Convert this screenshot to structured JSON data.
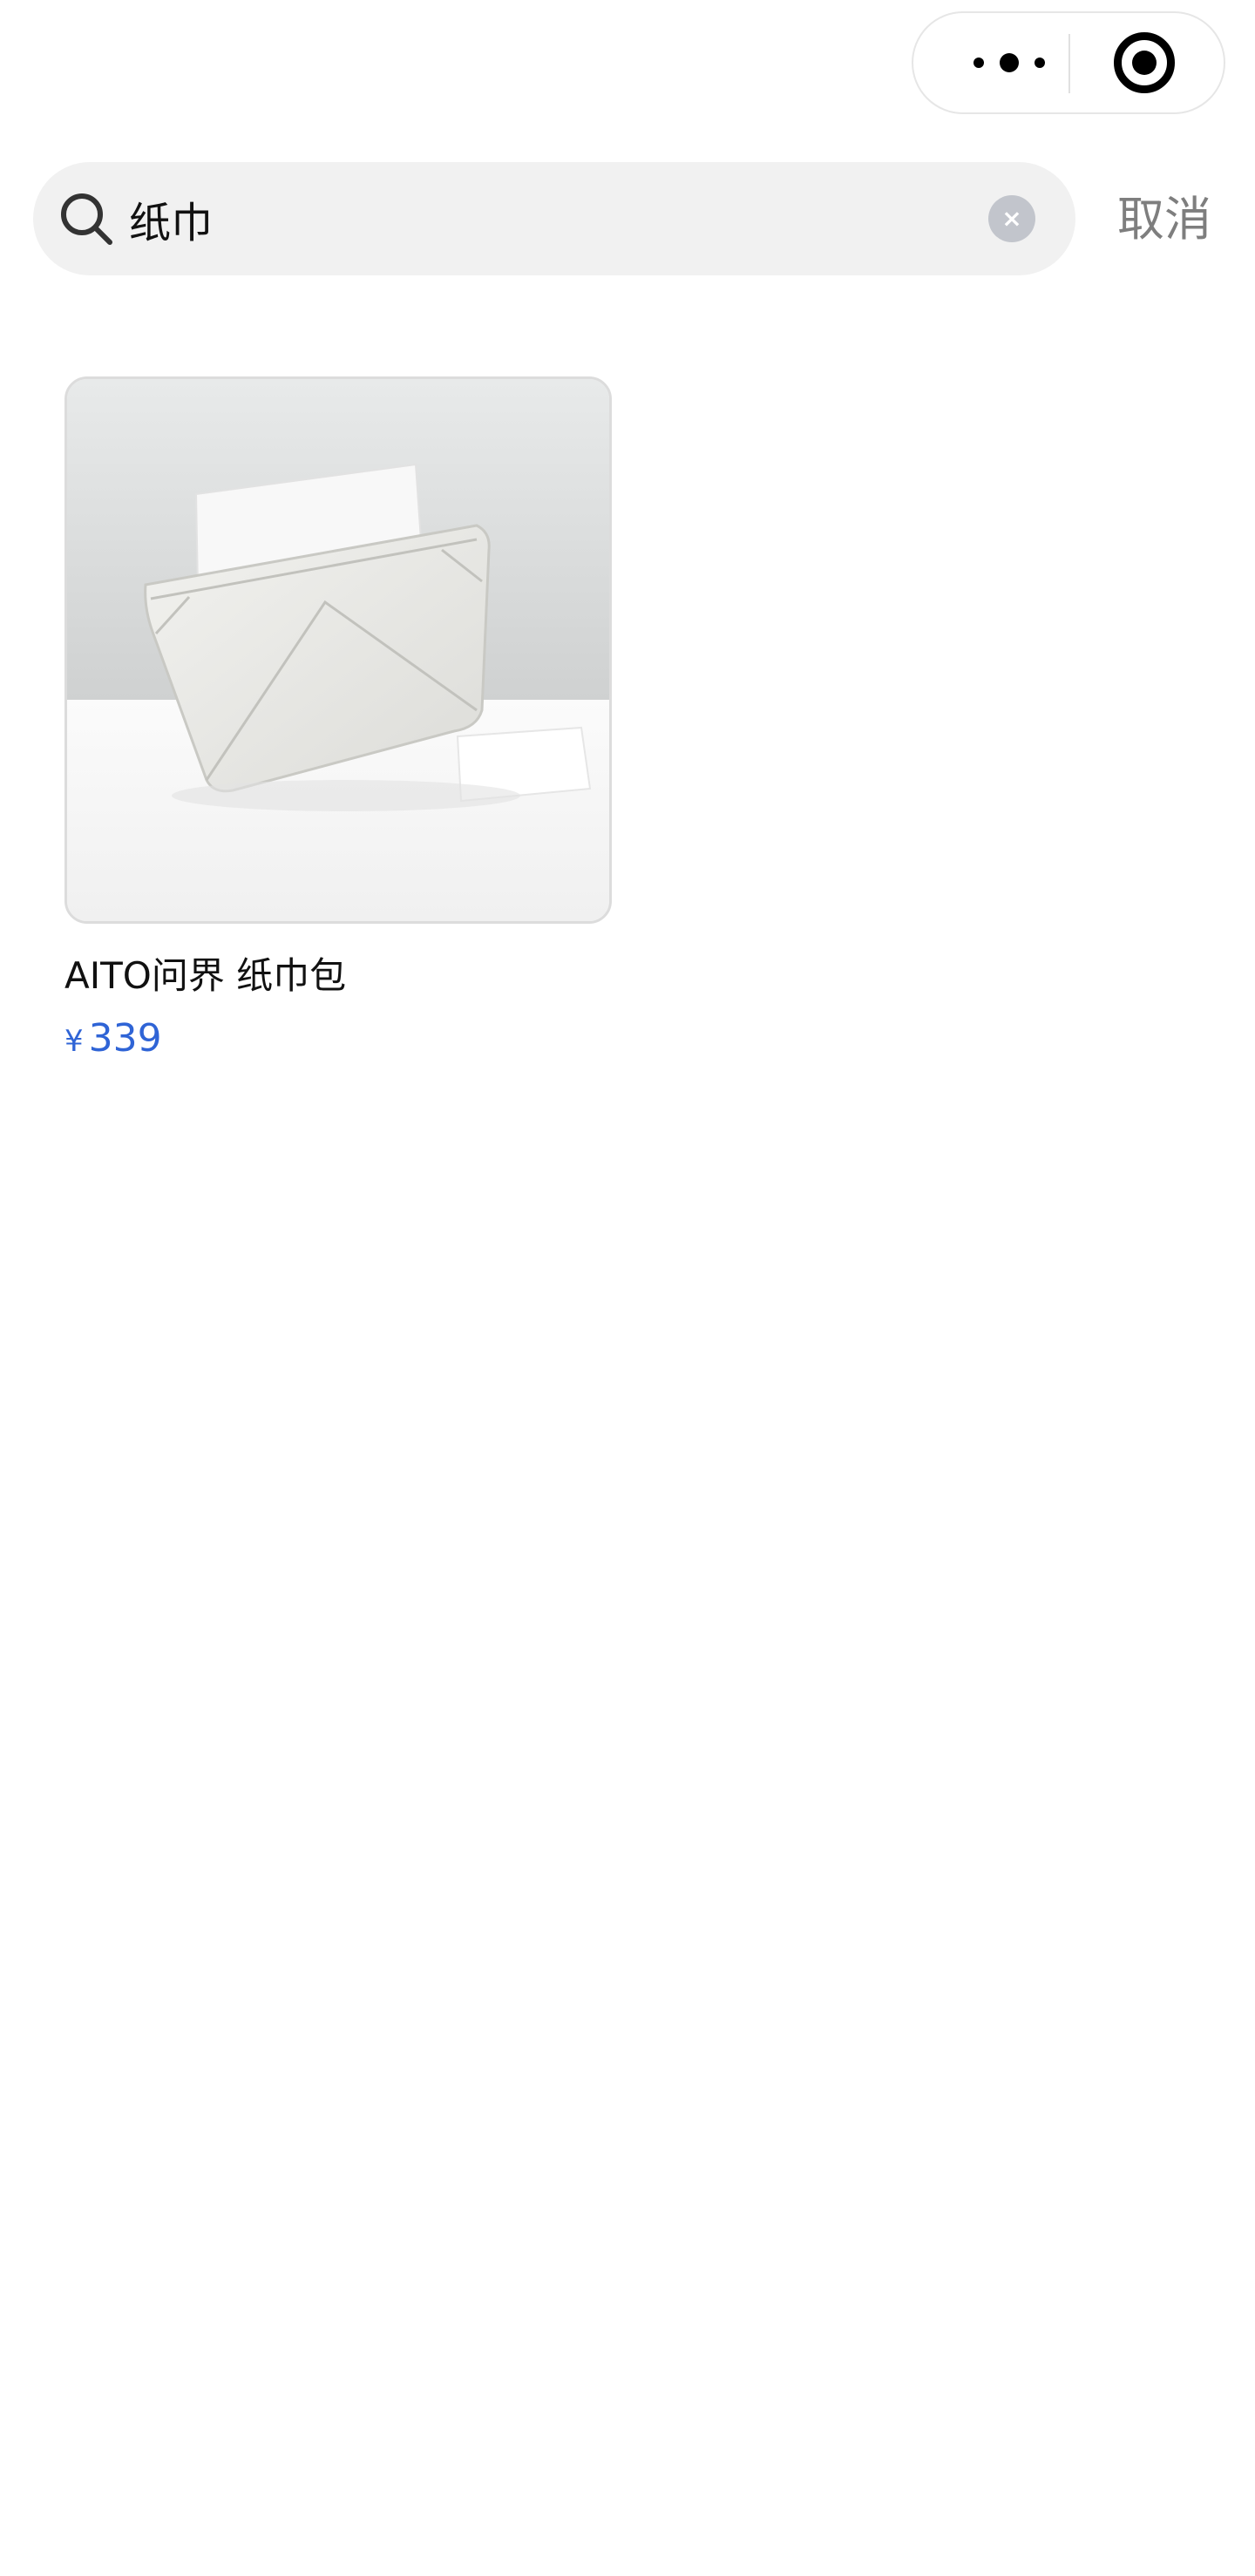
{
  "capsule": {
    "more_icon": "more-dots-icon",
    "close_icon": "target-circle-icon"
  },
  "search": {
    "query": "纸巾",
    "icon": "search-icon",
    "clear_icon": "clear-icon",
    "clear_glyph": "×",
    "cancel_label": "取消"
  },
  "results": [
    {
      "name": "AITO问界 纸巾包",
      "currency": "¥",
      "price": "339"
    }
  ],
  "colors": {
    "accent": "#2f64d6",
    "search_bg": "#f1f1f1",
    "cancel_text": "#7e7e7e"
  }
}
